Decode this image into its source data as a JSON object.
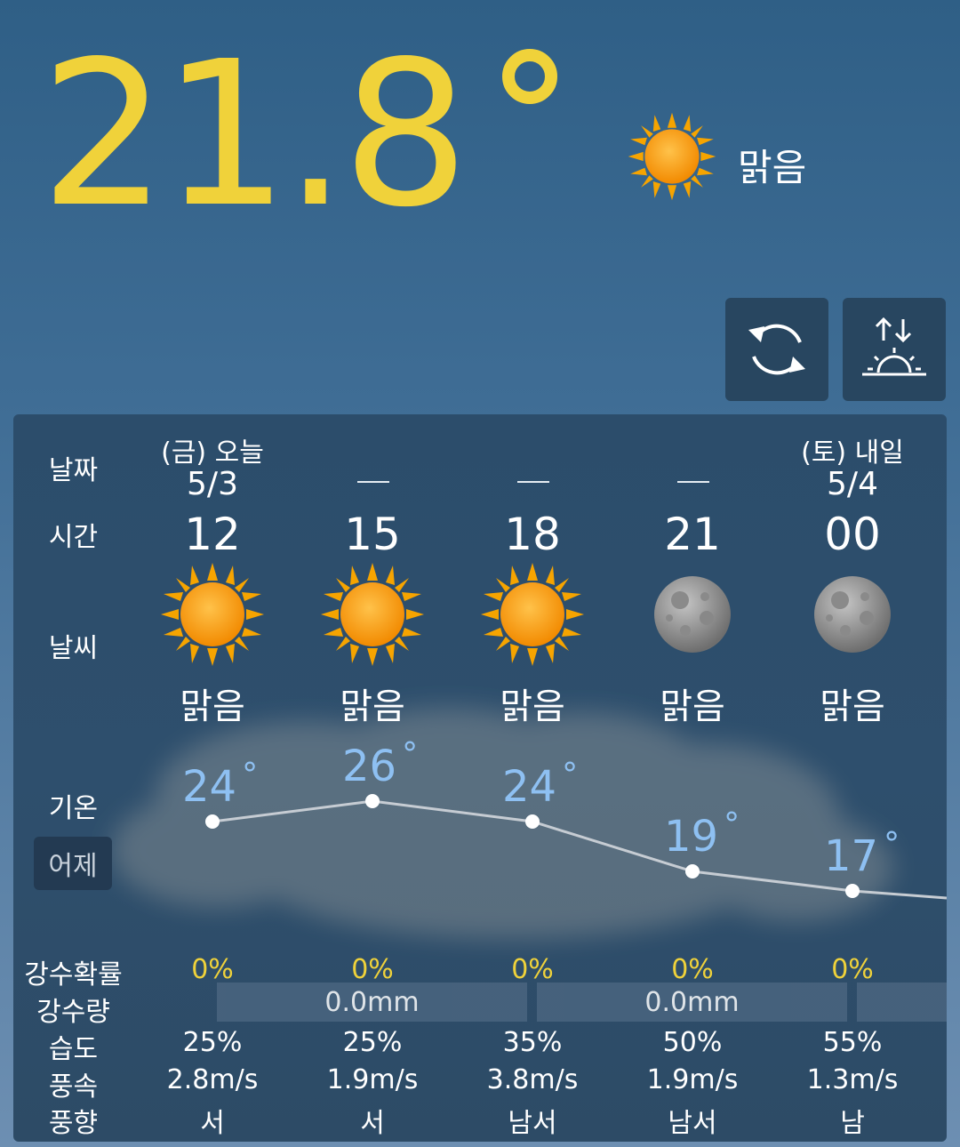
{
  "current": {
    "temperature": "21.8",
    "condition": "맑음",
    "icon": "sun-icon"
  },
  "buttons": {
    "refresh_icon": "refresh-icon",
    "sunrise_icon": "sunrise-sunset-icon"
  },
  "labels": {
    "date": "날짜",
    "time": "시간",
    "weather": "날씨",
    "temp": "기온",
    "yesterday": "어제",
    "rain_prob": "강수확률",
    "rain_amount": "강수량",
    "humidity": "습도",
    "wind_speed": "풍속",
    "wind_dir": "풍향"
  },
  "forecast": [
    {
      "date_top": "(금) 오늘",
      "date": "5/3",
      "hour": "12",
      "icon": "sun-icon",
      "cond": "맑음",
      "temp": "24",
      "pct": "0%",
      "humidity": "25%",
      "wind": "2.8m/s",
      "dir": "서"
    },
    {
      "date_top": "",
      "date": "",
      "hour": "15",
      "icon": "sun-icon",
      "cond": "맑음",
      "temp": "26",
      "pct": "0%",
      "humidity": "25%",
      "wind": "1.9m/s",
      "dir": "서"
    },
    {
      "date_top": "",
      "date": "",
      "hour": "18",
      "icon": "sun-icon",
      "cond": "맑음",
      "temp": "24",
      "pct": "0%",
      "humidity": "35%",
      "wind": "3.8m/s",
      "dir": "남서"
    },
    {
      "date_top": "",
      "date": "",
      "hour": "21",
      "icon": "moon-icon",
      "cond": "맑음",
      "temp": "19",
      "pct": "0%",
      "humidity": "50%",
      "wind": "1.9m/s",
      "dir": "남서"
    },
    {
      "date_top": "(토) 내일",
      "date": "5/4",
      "hour": "00",
      "icon": "moon-icon",
      "cond": "맑음",
      "temp": "17",
      "pct": "0%",
      "humidity": "55%",
      "wind": "1.3m/s",
      "dir": "남"
    }
  ],
  "rain_amounts": [
    "0.0mm",
    "0.0mm"
  ],
  "temp_degree_symbol": "°",
  "colors": {
    "temp_yellow": "#f0d23a",
    "temp_blue": "#8ec0f2",
    "pct_yellow": "#f0d23a"
  }
}
